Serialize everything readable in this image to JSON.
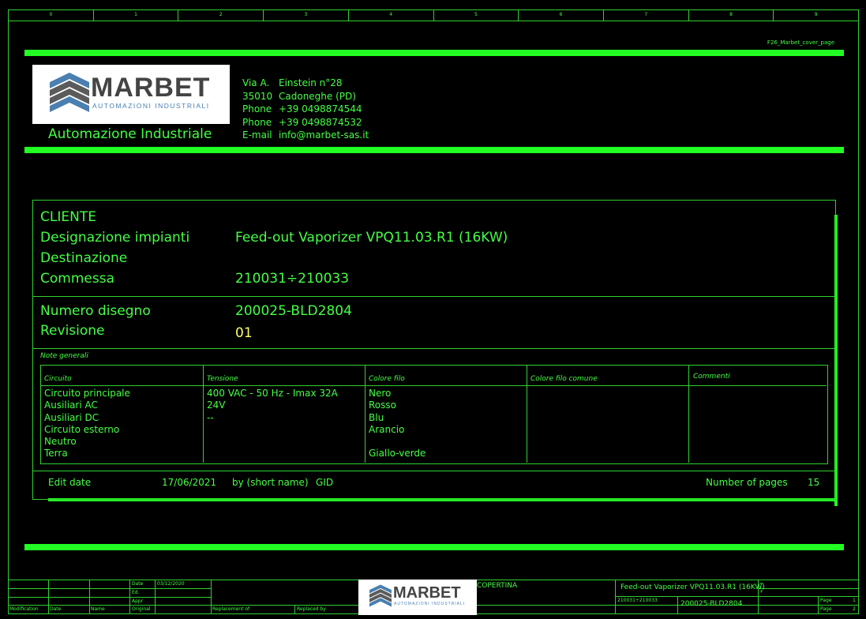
{
  "ruler": [
    "0",
    "1",
    "2",
    "3",
    "4",
    "5",
    "6",
    "7",
    "8",
    "9"
  ],
  "page_id": "F26_Marbet_cover_page",
  "company": {
    "logo_text": "MARBET",
    "logo_sub": "AUTOMAZIONI INDUSTRIALI",
    "tagline": "Automazione Industriale",
    "address": [
      {
        "label": "Via A.",
        "value": "Einstein n°28"
      },
      {
        "label": "35010",
        "value": "Cadoneghe (PD)"
      },
      {
        "label": "Phone",
        "value": "+39  0498874544"
      },
      {
        "label": "Phone",
        "value": "+39  0498874532"
      },
      {
        "label": "E-mail",
        "value": "info@marbet-sas.it"
      }
    ]
  },
  "info": {
    "cliente_label": "CLIENTE",
    "designazione_label": "Designazione impianti",
    "designazione_value": "Feed-out Vaporizer VPQ11.03.R1 (16KW)",
    "destinazione_label": "Destinazione",
    "commessa_label": "Commessa",
    "commessa_value": "210031÷210033",
    "numero_label": "Numero disegno",
    "numero_value": "200025-BLD2804",
    "revisione_label": "Revisione",
    "revisione_value": "01",
    "note_label": "Note generali"
  },
  "table": {
    "headers": [
      "Circuito",
      "Tensione",
      "Colore filo",
      "Colore filo comune",
      "Commenti"
    ],
    "circuito": [
      "Circuito principale",
      "Ausiliari AC",
      "Ausiliari DC",
      "Circuito esterno",
      "Neutro",
      "Terra"
    ],
    "tensione": [
      "400 VAC - 50 Hz - Imax 32A",
      "24V",
      "--",
      "",
      "",
      ""
    ],
    "colore": [
      "Nero",
      "Rosso",
      "Blu",
      "Arancio",
      "",
      "Giallo-verde"
    ]
  },
  "footer_info": {
    "edit_date_label": "Edit date",
    "edit_date_value": "17/06/2021",
    "by_label": "by (short name)",
    "by_value": "GID",
    "pages_label": "Number of pages",
    "pages_value": "15"
  },
  "titleblock": {
    "date_label": "Date",
    "date_value": "03/12/2020",
    "ed_label": "Ed.",
    "appr_label": "Appr",
    "original_label": "Original",
    "modification_label": "Modification",
    "date2_label": "Date",
    "name_label": "Name",
    "replacement_label": "Replacement of",
    "replaced_label": "Replaced by",
    "copertina": "COPERTINA",
    "title": "Feed-out Vaporizer VPQ11.03.R1 (16KW)",
    "commessa": "210031÷210033",
    "drawing": "200025-BLD2804",
    "eq": "=",
    "plus": "+",
    "page_label": "Page",
    "page_value": "1",
    "page_total": "2"
  },
  "colors": {
    "bg": "#000000",
    "line": "#2fd12f",
    "bar": "#22ff22",
    "rev": "#ffff66"
  }
}
